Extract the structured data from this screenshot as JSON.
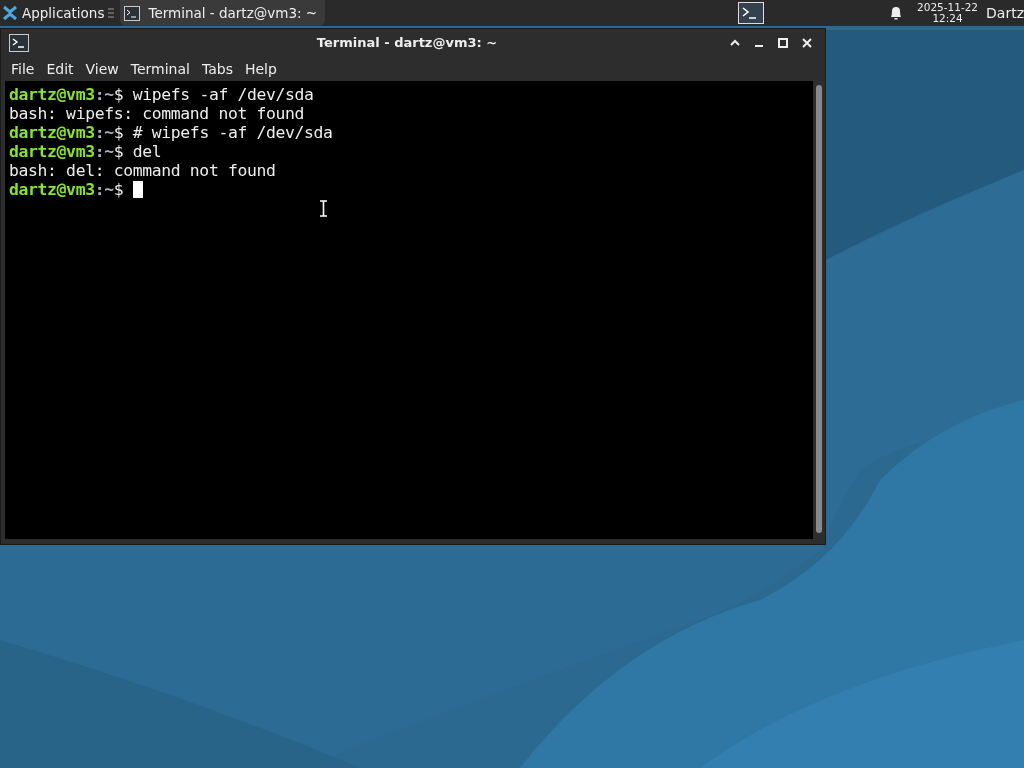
{
  "panel": {
    "apps_menu": "Applications",
    "tasks": [
      {
        "title": "Terminal - dartz@vm3: ~",
        "selected": true
      }
    ],
    "clock": {
      "date": "2025-11-22",
      "time": "12:24"
    },
    "user": "Dartz"
  },
  "window": {
    "title": "Terminal - dartz@vm3: ~",
    "menu": [
      "File",
      "Edit",
      "View",
      "Terminal",
      "Tabs",
      "Help"
    ],
    "lines": [
      {
        "kind": "prompt",
        "user": "dartz@vm3",
        "path": ":~",
        "symbol": "$",
        "command": "wipefs -af /dev/sda",
        "cursor": false
      },
      {
        "kind": "output",
        "text": "bash: wipefs: command not found"
      },
      {
        "kind": "prompt",
        "user": "dartz@vm3",
        "path": ":~",
        "symbol": "$",
        "command": "# wipefs -af /dev/sda",
        "cursor": false
      },
      {
        "kind": "prompt",
        "user": "dartz@vm3",
        "path": ":~",
        "symbol": "$",
        "command": "del",
        "cursor": false
      },
      {
        "kind": "output",
        "text": "bash: del: command not found"
      },
      {
        "kind": "prompt",
        "user": "dartz@vm3",
        "path": ":~",
        "symbol": "$",
        "cursor": true
      }
    ]
  }
}
